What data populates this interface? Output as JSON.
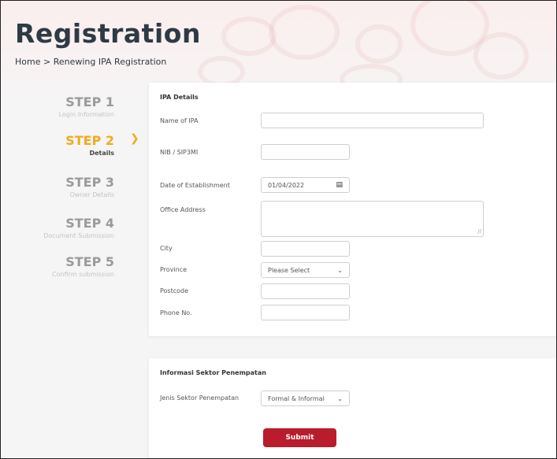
{
  "page": {
    "title": "Registration",
    "breadcrumb": "Home > Renewing IPA Registration"
  },
  "steps": [
    {
      "title": "STEP 1",
      "subtitle": "Login Information",
      "active": false
    },
    {
      "title": "STEP 2",
      "subtitle": "Details",
      "active": true
    },
    {
      "title": "STEP 3",
      "subtitle": "Owner Details",
      "active": false
    },
    {
      "title": "STEP 4",
      "subtitle": "Document Submission",
      "active": false
    },
    {
      "title": "STEP 5",
      "subtitle": "Confirm submission",
      "active": false
    }
  ],
  "ipa_details": {
    "section_title": "IPA Details",
    "fields": {
      "name": {
        "label": "Name of IPA",
        "value": ""
      },
      "nib": {
        "label": "NIB / SIP3MI",
        "value": ""
      },
      "date": {
        "label": "Date of Establishment",
        "value": "01/04/2022"
      },
      "address": {
        "label": "Office Address",
        "value": ""
      },
      "city": {
        "label": "City",
        "value": ""
      },
      "province": {
        "label": "Province",
        "value": "Please Select"
      },
      "postcode": {
        "label": "Postcode",
        "value": ""
      },
      "phone": {
        "label": "Phone No.",
        "value": ""
      }
    }
  },
  "sector": {
    "section_title": "Informasi Sektor Penempatan",
    "field": {
      "label": "Jenis Sektor Penempatan",
      "value": "Formal & Informal"
    },
    "submit_label": "Submit"
  },
  "icons": {
    "step_arrow": "chevron-right-icon",
    "calendar": "calendar-icon",
    "dropdown": "chevron-down-icon"
  },
  "colors": {
    "accent": "#f2a91a",
    "primary_button": "#b91c2c",
    "title": "#2e3a44"
  }
}
